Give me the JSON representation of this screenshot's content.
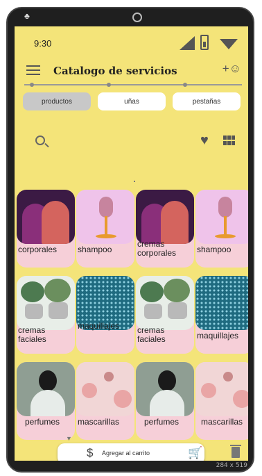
{
  "status": {
    "time": "9:30"
  },
  "header": {
    "title": "Catalogo de servicios"
  },
  "tabs": [
    {
      "label": "productos",
      "active": true
    },
    {
      "label": "uñas",
      "active": false
    },
    {
      "label": "pestañas",
      "active": false
    }
  ],
  "cards": [
    {
      "label": "corporales",
      "image": "silhouettes"
    },
    {
      "label": "shampoo",
      "image": "microphone"
    },
    {
      "label": "cremas corporales",
      "image": "silhouettes"
    },
    {
      "label": "shampoo",
      "image": "microphone"
    },
    {
      "label": "cremas faciales",
      "image": "plants"
    },
    {
      "label": "maquillajes",
      "image": "pattern"
    },
    {
      "label": "cremas faciales",
      "image": "plants"
    },
    {
      "label": "maquillajes",
      "image": "pattern"
    },
    {
      "label": "perfumes",
      "image": "woman"
    },
    {
      "label": "mascarillas",
      "image": "bubbles"
    },
    {
      "label": "perfumes",
      "image": "woman"
    },
    {
      "label": "mascarillas",
      "image": "bubbles"
    }
  ],
  "bottom_bar": {
    "add_to_cart_label": "Agregar al carrito"
  },
  "frame": {
    "size_label": "284 x 519"
  },
  "colors": {
    "background": "#f4e479",
    "card": "#f6cfd8"
  }
}
